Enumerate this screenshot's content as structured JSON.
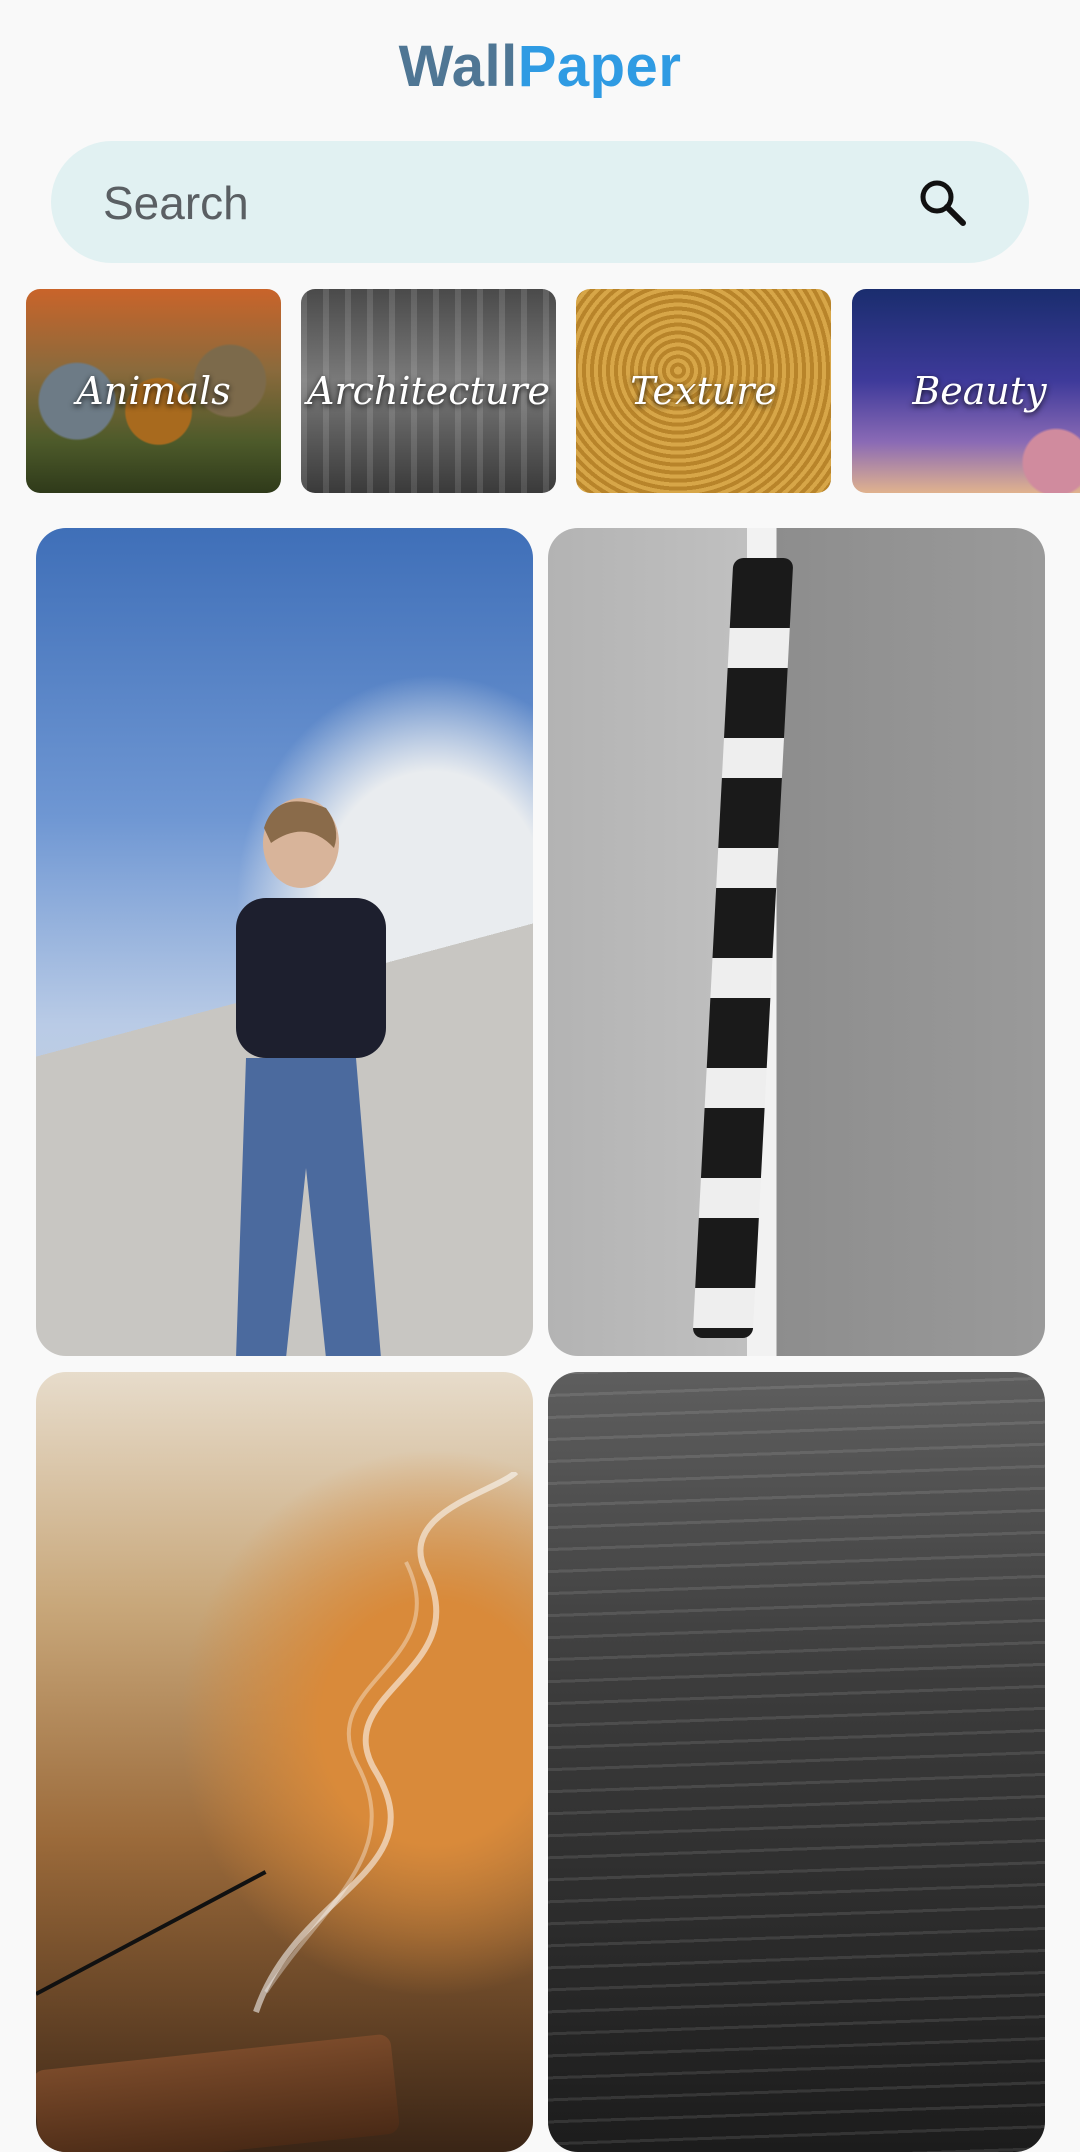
{
  "header": {
    "title_part1": "Wall",
    "title_part2": "Paper"
  },
  "search": {
    "placeholder": "Search",
    "value": "",
    "icon": "search-icon"
  },
  "categories": [
    {
      "label": "Animals"
    },
    {
      "label": "Architecture"
    },
    {
      "label": "Texture"
    },
    {
      "label": "Beauty"
    }
  ],
  "wallpapers": [
    {
      "subject": "woman-portrait"
    },
    {
      "subject": "building-facade"
    },
    {
      "subject": "incense-smoke"
    },
    {
      "subject": "ocean-waves"
    }
  ],
  "colors": {
    "title_primary": "#4f7694",
    "title_accent": "#2f9be3",
    "search_bg": "#e1f1f2",
    "page_bg": "#f9f9f9"
  }
}
